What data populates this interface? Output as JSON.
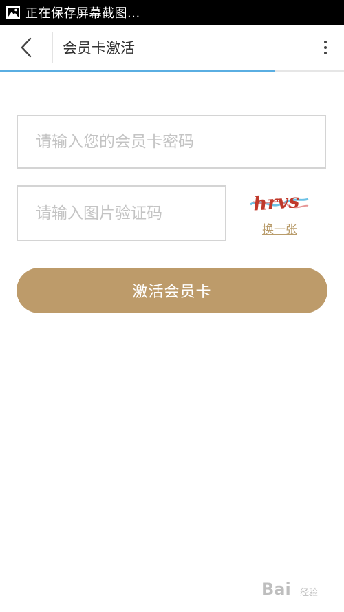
{
  "status_bar": {
    "text": "正在保存屏幕截图..."
  },
  "app_bar": {
    "title": "会员卡激活"
  },
  "progress": {
    "fraction": 0.8
  },
  "form": {
    "card_password_placeholder": "请输入您的会员卡密码",
    "captcha_placeholder": "请输入图片验证码",
    "captcha_text": "hrvs",
    "refresh_label": "换一张",
    "activate_label": "激活会员卡"
  },
  "colors": {
    "accent": "#bd9b6a",
    "progress": "#5aaee2",
    "link": "#b99c6b"
  },
  "watermark": {
    "text": "Bai",
    "sub": "经验"
  }
}
